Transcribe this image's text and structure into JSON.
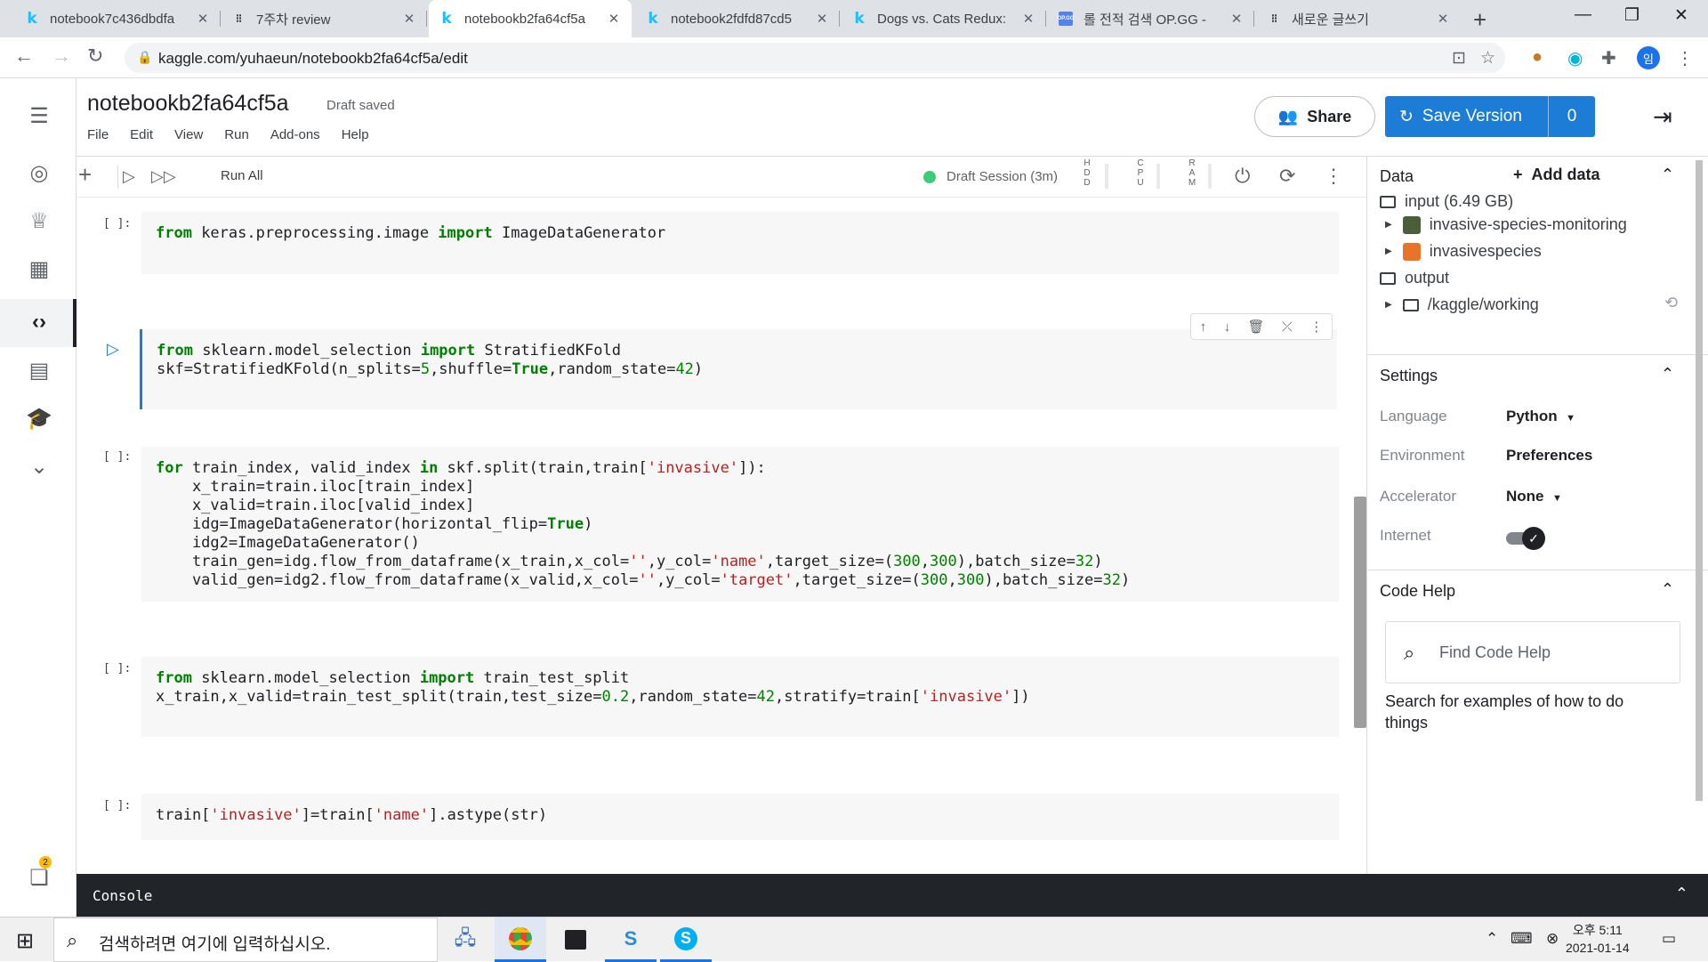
{
  "browser": {
    "tabs": [
      {
        "title": "notebook7c436dbdfa",
        "icon": "kaggle-k"
      },
      {
        "title": "7주차 review",
        "icon": "velog"
      },
      {
        "title": "notebookb2fa64cf5a",
        "icon": "kaggle-k"
      },
      {
        "title": "notebook2fdfd87cd5",
        "icon": "kaggle-k"
      },
      {
        "title": "Dogs vs. Cats Redux:",
        "icon": "kaggle-k"
      },
      {
        "title": "롤 전적 검색 OP.GG -",
        "icon": "opgg"
      },
      {
        "title": "새로운 글쓰기",
        "icon": "velog"
      }
    ],
    "url": "kaggle.com/yuhaeun/notebookb2fa64cf5a/edit",
    "profile_initial": "임"
  },
  "notebook": {
    "title": "notebookb2fa64cf5a",
    "status": "Draft saved",
    "menu": [
      "File",
      "Edit",
      "View",
      "Run",
      "Add-ons",
      "Help"
    ],
    "share_label": "Share",
    "save_label": "Save Version",
    "save_count": "0",
    "run_all_label": "Run All",
    "session_label": "Draft Session (3m)",
    "meters": [
      "HDD",
      "CPU",
      "RAM"
    ]
  },
  "cells": [
    {
      "prompt": "[ ]:",
      "code": "from keras.preprocessing.image import ImageDataGenerator"
    },
    {
      "prompt": "",
      "code": "from sklearn.model_selection import StratifiedKFold\nskf=StratifiedKFold(n_splits=5,shuffle=True,random_state=42)"
    },
    {
      "prompt": "[ ]:",
      "code": "for train_index, valid_index in skf.split(train,train['invasive']):\n    x_train=train.iloc[train_index]\n    x_valid=train.iloc[valid_index]\n    idg=ImageDataGenerator(horizontal_flip=True)\n    idg2=ImageDataGenerator()\n    train_gen=idg.flow_from_dataframe(x_train,x_col='',y_col='name',target_size=(300,300),batch_size=32)\n    valid_gen=idg2.flow_from_dataframe(x_valid,x_col='',y_col='target',target_size=(300,300),batch_size=32)"
    },
    {
      "prompt": "[ ]:",
      "code": "from sklearn.model_selection import train_test_split\nx_train,x_valid=train_test_split(train,test_size=0.2,random_state=42,stratify=train['invasive'])"
    },
    {
      "prompt": "[ ]:",
      "code": "train['invasive']=train['name'].astype(str)"
    }
  ],
  "console_label": "Console",
  "panel": {
    "data_title": "Data",
    "add_data": "Add data",
    "input_label": "input (6.49 GB)",
    "datasets": [
      "invasive-species-monitoring",
      "invasivespecies"
    ],
    "output_label": "output",
    "output_path": "/kaggle/working",
    "settings_title": "Settings",
    "settings": [
      {
        "label": "Language",
        "value": "Python"
      },
      {
        "label": "Environment",
        "value": "Preferences"
      },
      {
        "label": "Accelerator",
        "value": "None"
      },
      {
        "label": "Internet",
        "value": ""
      }
    ],
    "internet_on": true,
    "code_help_title": "Code Help",
    "search_placeholder": "Find Code Help",
    "help_text": "Search for examples of how to do things"
  },
  "nav_badge": "2",
  "taskbar": {
    "search_placeholder": "검색하려면 여기에 입력하십시오.",
    "time": "오후 5:11",
    "date": "2021-01-14"
  }
}
